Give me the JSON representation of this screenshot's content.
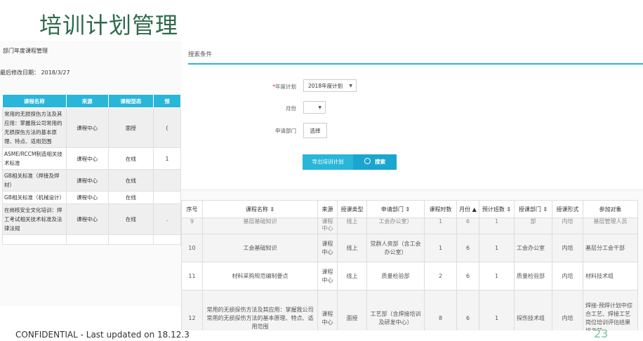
{
  "slide": {
    "title": "培训计划管理",
    "footer_confidential": "CONFIDENTIAL - Last updated on 18.12.3",
    "page_number": "23"
  },
  "left_panel": {
    "header": "部门年度课程管理",
    "last_modified": "最后修改日期： 2018/3/27",
    "columns": [
      "课程名称",
      "来源",
      "课程型态",
      "预"
    ],
    "rows": [
      [
        "常用的无损探伤方法及其应用：掌握我公司常用的无损探伤方法的基本原理、特点、适用范围",
        "课程中心",
        "面授",
        "("
      ],
      [
        "ASME/RCCM制造相关技术标准",
        "课程中心",
        "在线",
        "1"
      ],
      [
        "GB相关标准（焊接及焊材）",
        "课程中心",
        "在线",
        ""
      ],
      [
        "GB相关标准（机械设计）",
        "课程中心",
        "在线",
        ""
      ],
      [
        "在岗核安全文化培训：焊工考试相关技术标准及法律法规",
        "课程中心",
        "在线",
        "."
      ],
      [
        "",
        "",
        "",
        ""
      ]
    ]
  },
  "search": {
    "title": "搜索条件",
    "year_plan_label_req": "*",
    "year_plan_label": "年度计划",
    "year_plan_value": "2018年度计划",
    "month_label": "月份",
    "month_value": "",
    "dept_label": "申请部门",
    "dept_button": "选择",
    "export_button": "导出培训计划",
    "search_button": "搜索",
    "caret": "▼",
    "search_icon": "🔍"
  },
  "results": {
    "columns": [
      "序号",
      "课程名称 ⇕",
      "来源",
      "授课类型",
      "申请部门 ⇕",
      "课程时数",
      "月份 ▲",
      "预计班数 ⇕",
      "授课部门 ⇕",
      "授课形式",
      "参加对象"
    ],
    "partial_row": [
      "9",
      "基层基础知识",
      "课程中心",
      "线上",
      "工会办公室）",
      "1",
      "6",
      "1",
      "部",
      "内培",
      "基层管理人员"
    ],
    "rows": [
      [
        "10",
        "工会基础知识",
        "课程中心",
        "线上",
        "党群人资部（含工会办公室）",
        "1",
        "6",
        "1",
        "工会办公室",
        "内培",
        "基层分工会干部"
      ],
      [
        "11",
        "材料采购规范编制要点",
        "课程中心",
        "线上",
        "质量检验部",
        "2",
        "6",
        "1",
        "质量检验部",
        "内培",
        "材料技术组"
      ],
      [
        "12",
        "常用的无损探伤方法及其应用：掌握我公司常用的无损探伤方法的基本原理、特点、适用范围",
        "课程中心",
        "面授",
        "工艺部（含焊接培训及研发中心）",
        "8",
        "6",
        "1",
        "探伤技术组",
        "内培",
        "焊接-预焊计划中综合工艺、焊接工艺岗位培训评估结果排名前"
      ]
    ]
  }
}
